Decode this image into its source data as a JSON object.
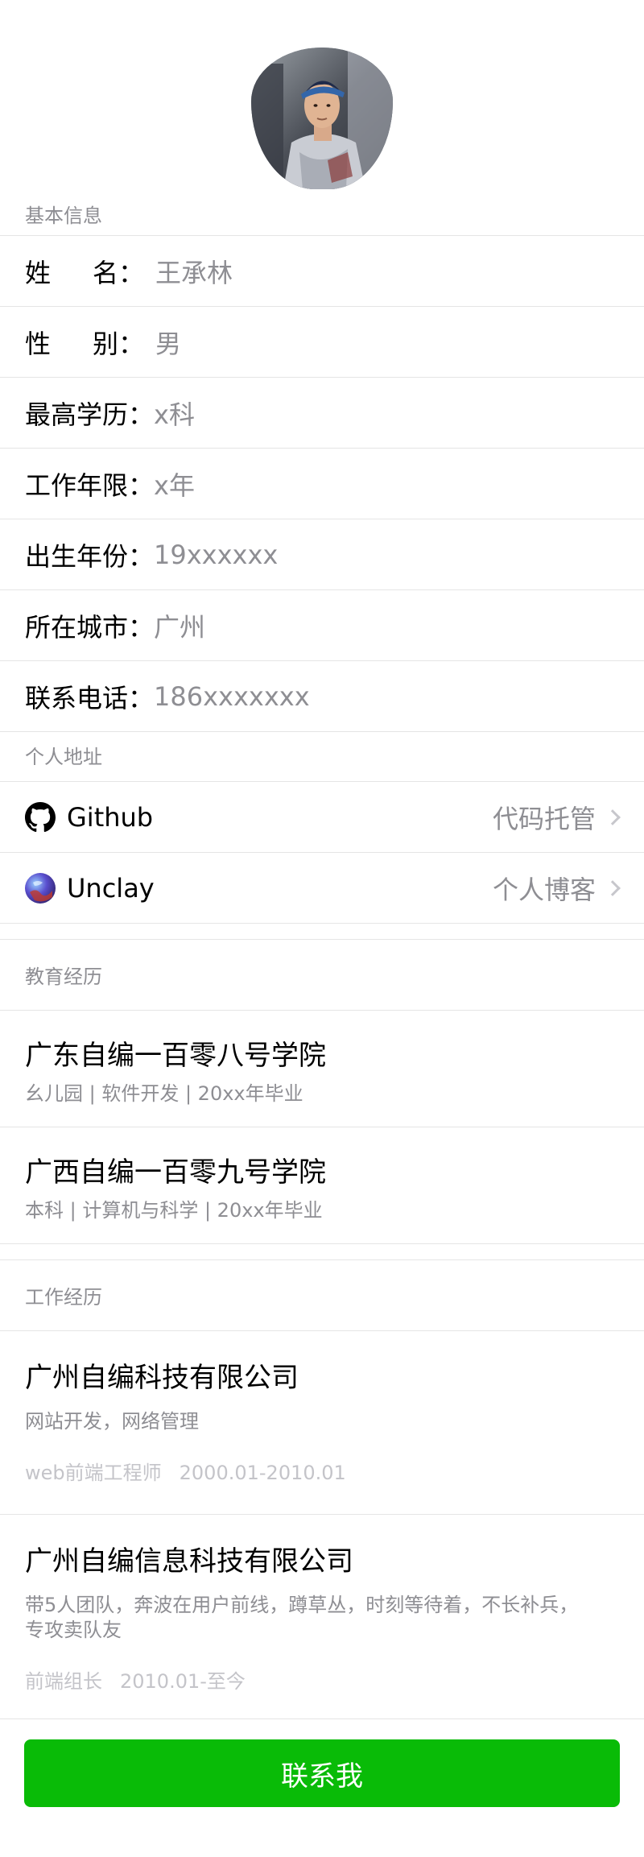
{
  "sections": {
    "basic_info": "基本信息",
    "personal_links": "个人地址",
    "education": "教育经历",
    "work": "工作经历"
  },
  "basic": {
    "name": {
      "k1": "姓",
      "k2": "名：",
      "value": "王承林"
    },
    "gender": {
      "k1": "性",
      "k2": "别：",
      "value": "男"
    },
    "degree": {
      "key": "最高学历：",
      "value": "x科"
    },
    "years": {
      "key": "工作年限：",
      "value": "x年"
    },
    "birth": {
      "key": "出生年份：",
      "value": "19xxxxxx"
    },
    "city": {
      "key": "所在城市：",
      "value": "广州"
    },
    "phone": {
      "key": "联系电话：",
      "value": "186xxxxxxx"
    }
  },
  "links": [
    {
      "label": "Github",
      "desc": "代码托管",
      "icon": "github-icon"
    },
    {
      "label": "Unclay",
      "desc": "个人博客",
      "icon": "unclay-icon"
    }
  ],
  "education": [
    {
      "title": "广东自编一百零八号学院",
      "sub": "幺儿园 | 软件开发 | 20xx年毕业"
    },
    {
      "title": "广西自编一百零九号学院",
      "sub": "本科 | 计算机与科学 | 20xx年毕业"
    }
  ],
  "work": [
    {
      "title": "广州自编科技有限公司",
      "desc": "网站开发，网络管理",
      "role": "web前端工程师",
      "period": "2000.01-2010.01"
    },
    {
      "title": "广州自编信息科技有限公司",
      "desc": "带5人团队，奔波在用户前线，蹲草丛，时刻等待着，不长补兵，专攻卖队友",
      "role": "前端组长",
      "period": "2010.01-至今"
    }
  ],
  "contact_button": "联系我",
  "colors": {
    "accent": "#09bb07",
    "secondary_text": "#8e8e93",
    "divider": "#e5e5e5"
  }
}
